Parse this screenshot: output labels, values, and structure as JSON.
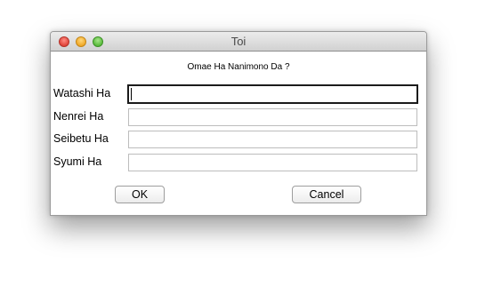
{
  "window": {
    "title": "Toi",
    "buttons": [
      "close",
      "minimize",
      "zoom"
    ]
  },
  "dialog": {
    "prompt": "Omae Ha Nanimono Da ?",
    "fields": [
      {
        "label": "Watashi Ha",
        "value": "",
        "focused": true
      },
      {
        "label": "Nenrei Ha",
        "value": ""
      },
      {
        "label": "Seibetu Ha",
        "value": ""
      },
      {
        "label": "Syumi Ha",
        "value": ""
      }
    ],
    "ok_label": "OK",
    "cancel_label": "Cancel"
  }
}
